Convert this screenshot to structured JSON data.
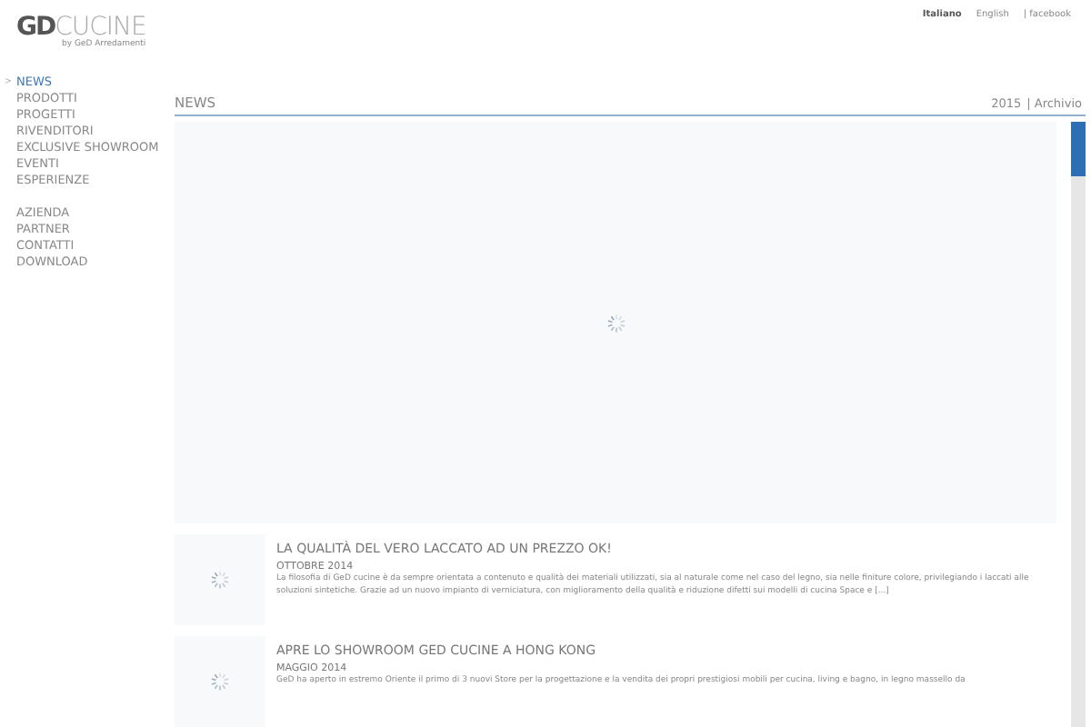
{
  "logo": {
    "brand_bold": "GD",
    "brand_light": "CUCINE",
    "tagline": "by GeD Arredamenti"
  },
  "languages": [
    {
      "label": "Italiano",
      "selected": true
    },
    {
      "label": "English",
      "selected": false
    }
  ],
  "social_link": "| facebook",
  "nav_groups": [
    [
      {
        "label": "NEWS",
        "selected": true
      },
      {
        "label": "PRODOTTI",
        "selected": false
      },
      {
        "label": "PROGETTI",
        "selected": false
      },
      {
        "label": "RIVENDITORI",
        "selected": false
      },
      {
        "label": "EXCLUSIVE SHOWROOM",
        "selected": false
      },
      {
        "label": "EVENTI",
        "selected": false
      },
      {
        "label": "ESPERIENZE",
        "selected": false
      }
    ],
    [
      {
        "label": "AZIENDA",
        "selected": false
      },
      {
        "label": "PARTNER",
        "selected": false
      },
      {
        "label": "CONTATTI",
        "selected": false
      },
      {
        "label": "DOWNLOAD",
        "selected": false
      }
    ]
  ],
  "nav_marker": ">",
  "section_title": "NEWS",
  "year_link": "2015",
  "archive_link": "| Archivio",
  "news": [
    {
      "title": "LA QUALITÀ DEL VERO LACCATO AD UN PREZZO OK!",
      "date": "OTTOBRE 2014",
      "excerpt": "La filosofia di GeD cucine è da sempre orientata a contenuto e qualità dei materiali utilizzati, sia al naturale come nel caso del legno, sia nelle finiture colore, privilegiando i laccati alle soluzioni sintetiche. Grazie ad un nuovo impianto di verniciatura, con miglioramento della qualità e riduzione difetti sui modelli di cucina Space e [...]"
    },
    {
      "title": "APRE LO SHOWROOM GED CUCINE A HONG KONG",
      "date": "MAGGIO 2014",
      "excerpt": "GeD ha aperto in estremo Oriente il primo di 3 nuovi Store per la progettazione e la vendita dei propri prestigiosi mobili per cucina, living e bagno, in legno massello da"
    }
  ]
}
